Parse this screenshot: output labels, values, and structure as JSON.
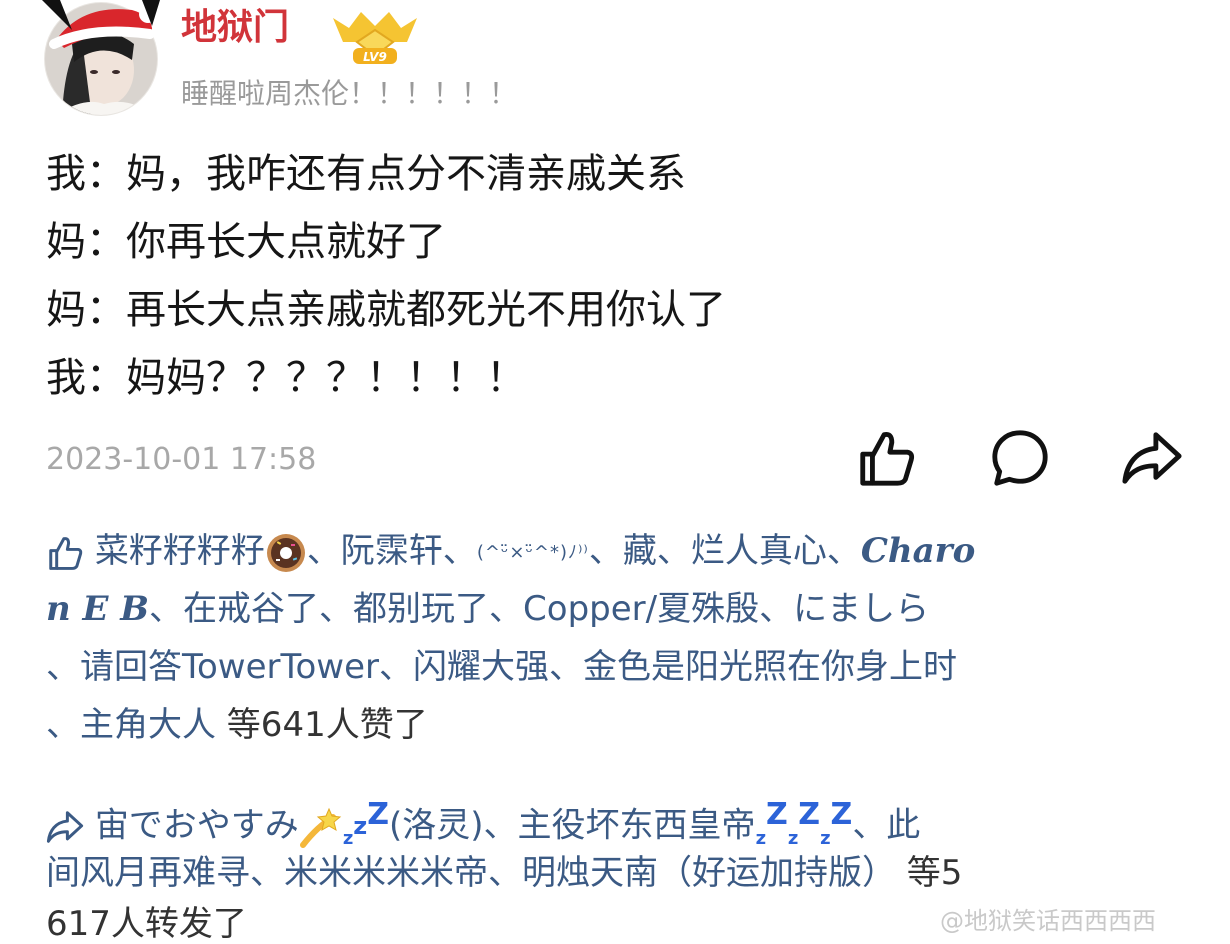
{
  "header": {
    "username": "地狱门",
    "level_badge": "LV9",
    "subtitle": "睡醒啦周杰伦！！！！！！"
  },
  "post": {
    "lines": [
      "我：妈，我咋还有点分不清亲戚关系",
      "妈：你再长大点就好了",
      "妈：再长大点亲戚就都死光不用你认了",
      "我：妈妈？？？？！！！！"
    ],
    "timestamp": "2023-10-01 17:58"
  },
  "actions": {
    "like_icon": "thumbs-up-icon",
    "comment_icon": "comment-bubble-icon",
    "share_icon": "share-arrow-icon"
  },
  "likes": {
    "icon": "thumbs-up-icon",
    "row1": {
      "n1": "菜籽籽籽籽",
      "sep1": "、阮霂轩、",
      "kaomoji": "(^ᵕ̈×ᵕ̈^*)ﾉ⁾⁾",
      "sep2": "、藏、烂人真心、",
      "charon_a": "Charo"
    },
    "row2": {
      "charon_b": "n E B",
      "rest": "、在戒谷了、都别玩了、Copper/夏殊殷、にましら"
    },
    "row3": "、请回答TowerTower、闪耀大强、金色是阳光照在你身上时",
    "row4_names": "、主角大人",
    "row4_count": " 等641人赞了"
  },
  "reposts": {
    "icon": "share-arrow-icon",
    "row1": {
      "n1": "宙でおやすみ",
      "n1_tail": "(洛灵)、主役坏东西皇帝",
      "tail": "、此"
    },
    "row2_names": "间风月再难寻、米米米米米帝、明烛天南（好运加持版）",
    "row2_count": " 等5",
    "row3_clip": "617人转发了"
  },
  "watermark": "@地狱笑话西西西西",
  "colors": {
    "username": "#d1343a",
    "link": "#3b5a84",
    "meta": "#a8a8a8",
    "zz": "#2c63d8"
  }
}
